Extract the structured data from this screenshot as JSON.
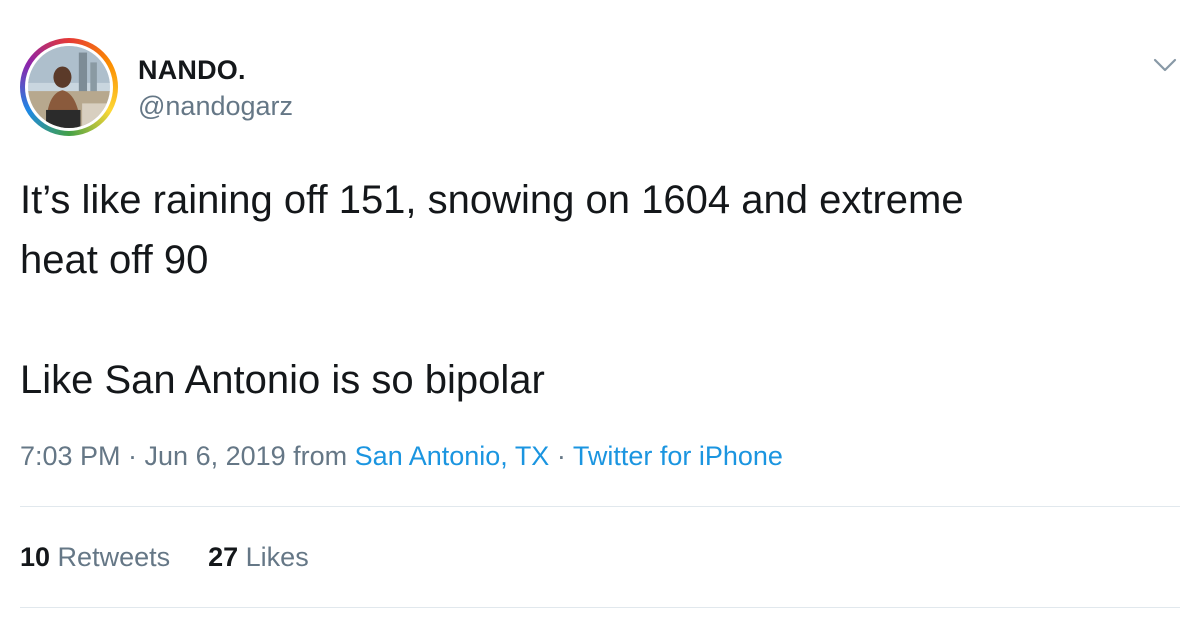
{
  "user": {
    "display_name": "NANDO.",
    "handle": "@nandogarz"
  },
  "tweet": {
    "text_line_1": "It’s like raining off 151, snowing on 1604 and extreme",
    "text_line_2": "heat off 90",
    "text_line_3": "Like San Antonio is so bipolar"
  },
  "meta": {
    "time_date": "7:03 PM · Jun 6, 2019 from ",
    "location": "San Antonio, TX",
    "separator": " · ",
    "source": "Twitter for iPhone"
  },
  "stats": {
    "retweets_count": "10",
    "retweets_label": " Retweets",
    "likes_count": "27",
    "likes_label": " Likes"
  },
  "icons": {
    "menu": "chevron-down-icon",
    "avatar": "profile-photo"
  },
  "colors": {
    "text_primary": "#14171a",
    "text_secondary": "#657786",
    "link": "#1b95e0",
    "divider": "#e1e8ed"
  }
}
